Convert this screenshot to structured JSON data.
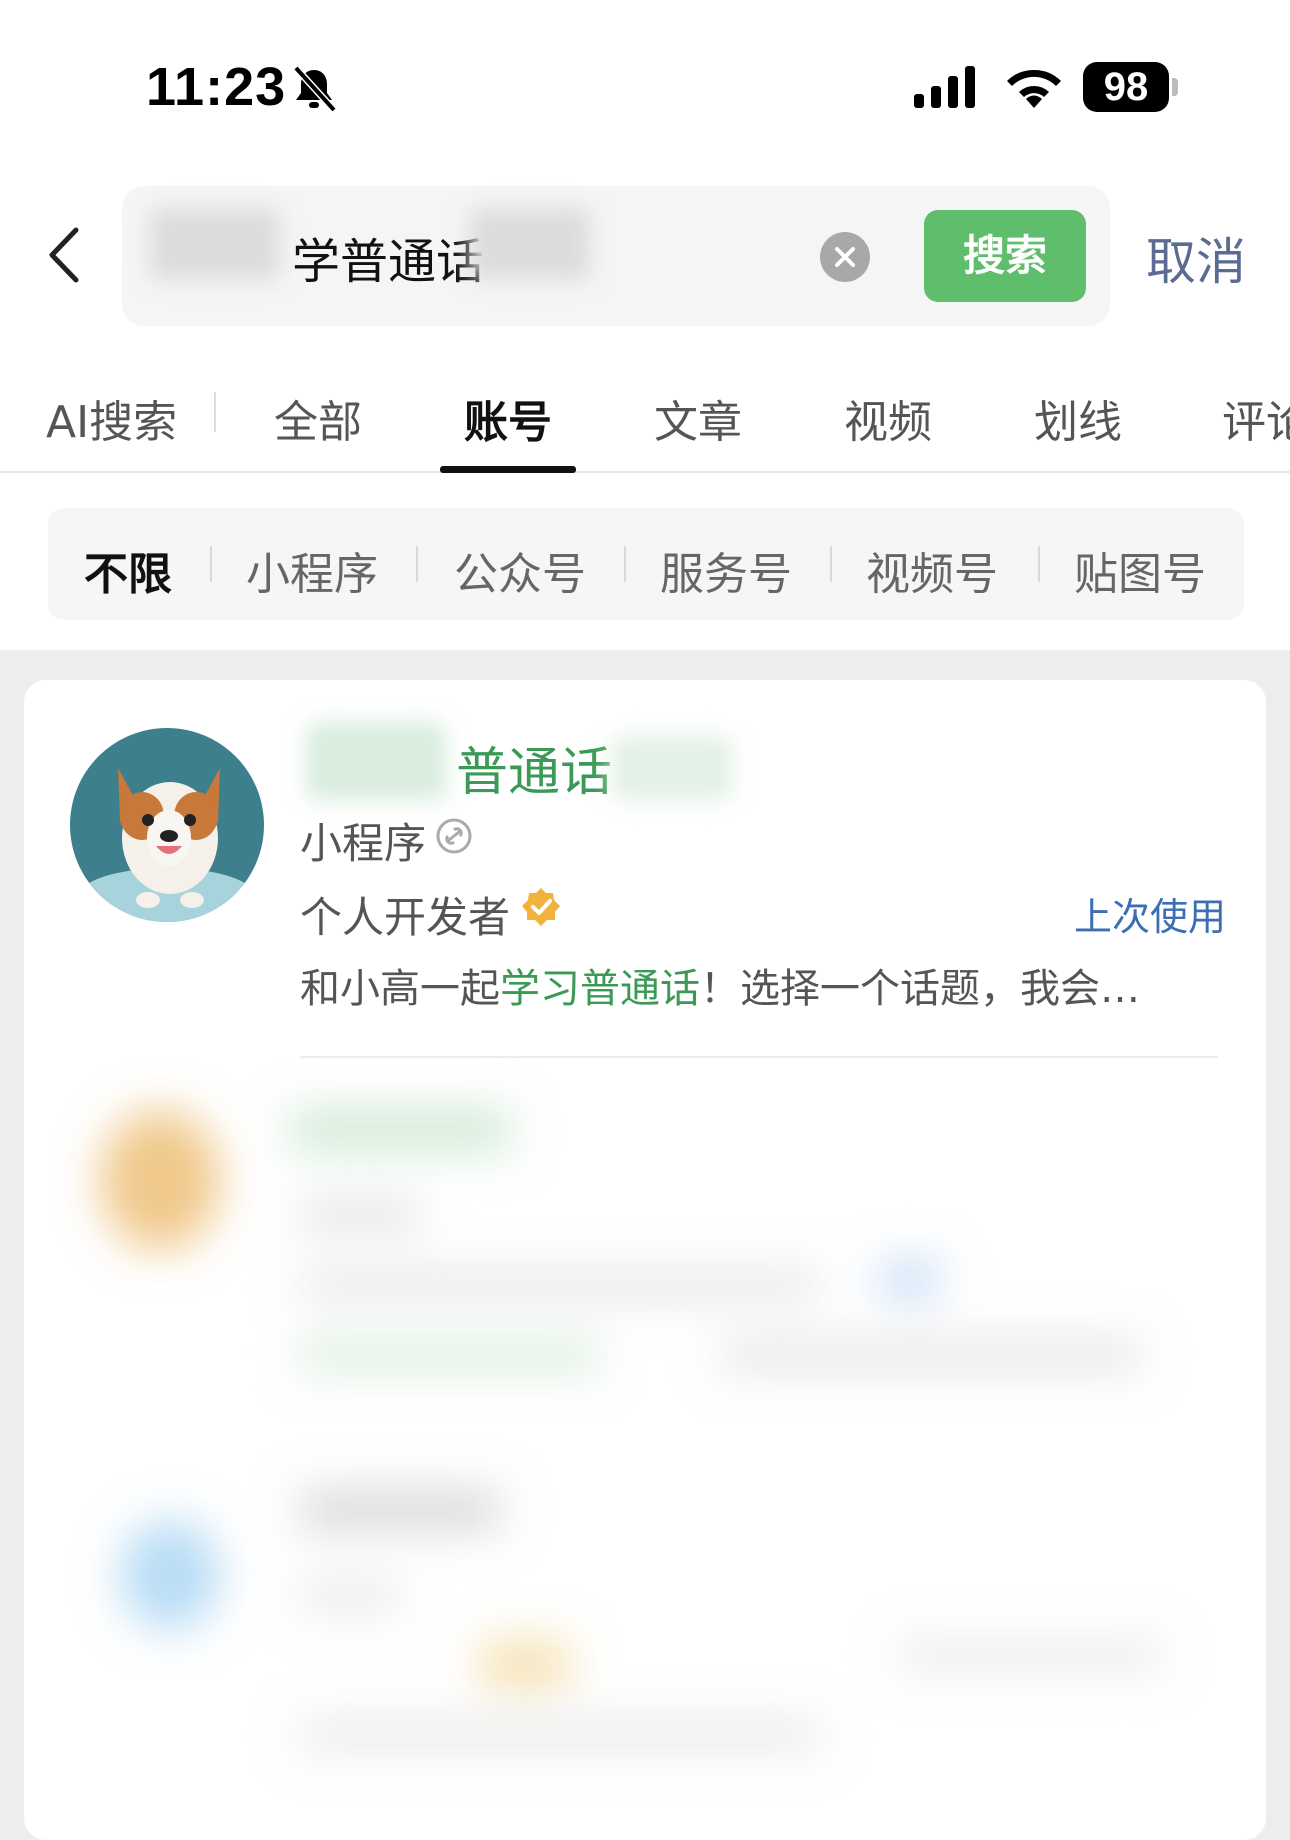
{
  "status_bar": {
    "time": "11:23",
    "battery": "98"
  },
  "search": {
    "query": "学普通话",
    "button": "搜索",
    "cancel": "取消"
  },
  "tabs": [
    "AI搜索",
    "全部",
    "账号",
    "文章",
    "视频",
    "划线",
    "评论"
  ],
  "active_tab": "账号",
  "filters": [
    "不限",
    "小程序",
    "公众号",
    "服务号",
    "视频号",
    "贴图号"
  ],
  "active_filter": "不限",
  "result": {
    "title": "普通话",
    "type": "小程序",
    "developer": "个人开发者",
    "last_used": "上次使用",
    "desc_prefix": "和小高一起",
    "desc_highlight": "学习普通话",
    "desc_suffix": "！选择一个话题，我会…"
  },
  "colors": {
    "green": "#5fbe6b",
    "title_green": "#3a9a55",
    "link_blue": "#3c6eb4",
    "cancel_blue": "#5b6b92"
  },
  "icons": [
    "bell-muted-icon",
    "signal-icon",
    "wifi-icon",
    "back-icon",
    "clear-icon",
    "link-icon",
    "verified-icon"
  ]
}
